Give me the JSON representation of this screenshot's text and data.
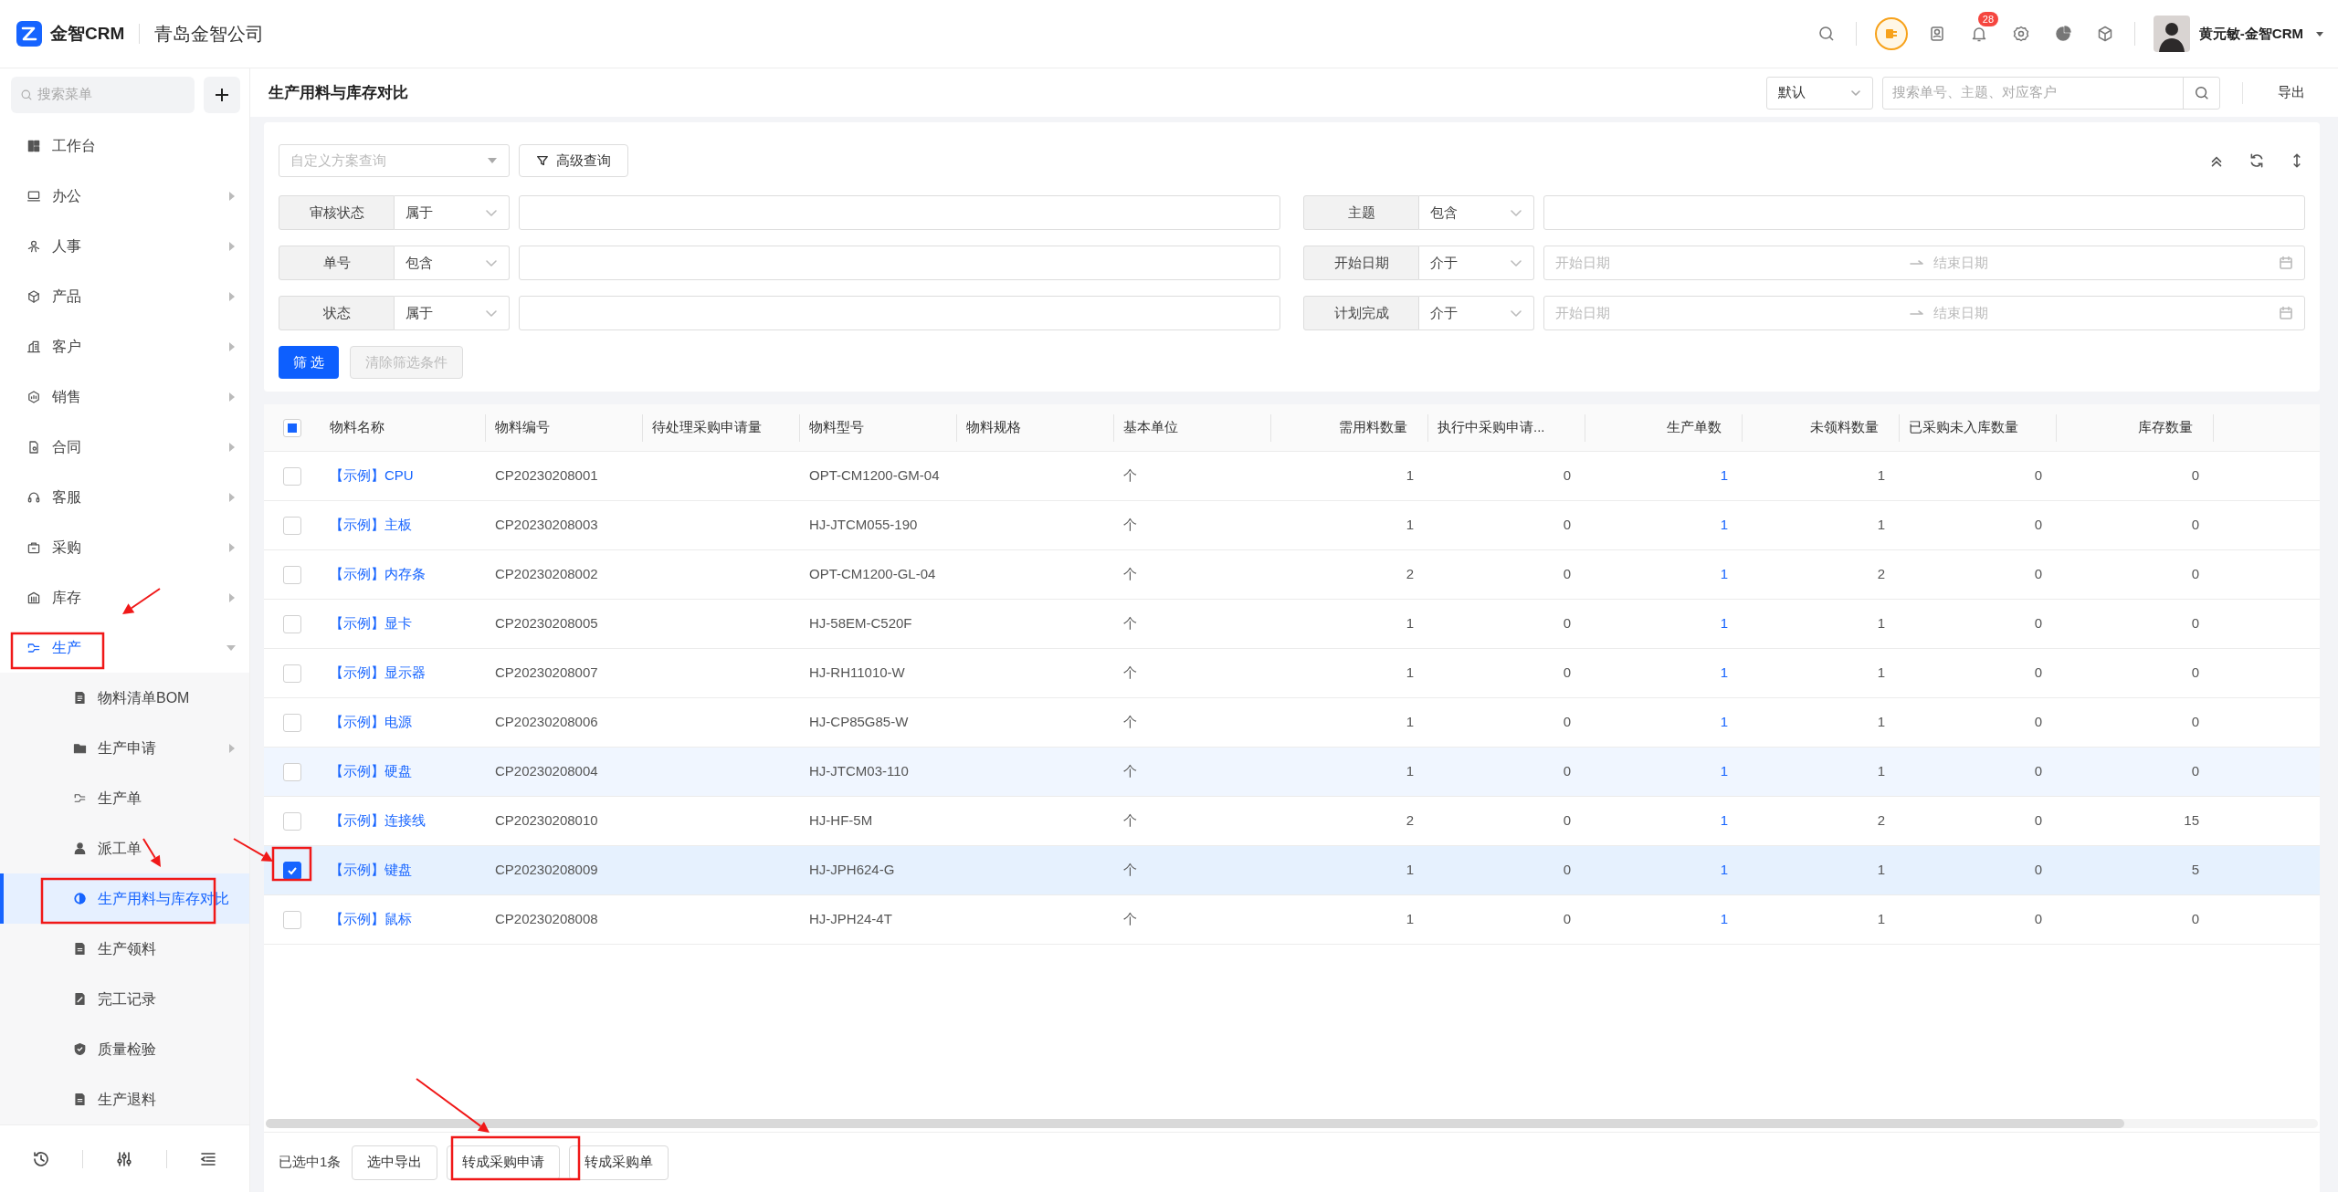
{
  "header": {
    "logo_text": "金智CRM",
    "company": "青岛金智公司",
    "notification_count": "28",
    "user_name": "黄元敏-金智CRM"
  },
  "sidebar": {
    "search_placeholder": "搜索菜单",
    "items": [
      {
        "label": "工作台",
        "selected": false
      },
      {
        "label": "办公",
        "selected": false,
        "expanded": false
      },
      {
        "label": "人事",
        "selected": false,
        "expanded": false
      },
      {
        "label": "产品",
        "selected": false,
        "expanded": false
      },
      {
        "label": "客户",
        "selected": false,
        "expanded": false
      },
      {
        "label": "销售",
        "selected": false,
        "expanded": false
      },
      {
        "label": "合同",
        "selected": false,
        "expanded": false
      },
      {
        "label": "客服",
        "selected": false,
        "expanded": false
      },
      {
        "label": "采购",
        "selected": false,
        "expanded": false
      },
      {
        "label": "库存",
        "selected": false,
        "expanded": false
      },
      {
        "label": "生产",
        "selected": false,
        "expanded": true,
        "children": [
          {
            "label": "物料清单BOM",
            "selected": false
          },
          {
            "label": "生产申请",
            "selected": false,
            "expanded": false
          },
          {
            "label": "生产单",
            "selected": false
          },
          {
            "label": "派工单",
            "selected": false
          },
          {
            "label": "生产用料与库存对比",
            "selected": true
          },
          {
            "label": "生产领料",
            "selected": false
          },
          {
            "label": "完工记录",
            "selected": false
          },
          {
            "label": "质量检验",
            "selected": false
          },
          {
            "label": "生产退料",
            "selected": false
          }
        ]
      }
    ]
  },
  "page": {
    "title": "生产用料与库存对比",
    "view_select": "默认",
    "search_placeholder": "搜索单号、主题、对应客户",
    "export": "导出"
  },
  "filter": {
    "scheme_placeholder": "自定义方案查询",
    "advanced_button": "高级查询",
    "fields": [
      {
        "label": "审核状态",
        "operator": "属于",
        "kind": "text"
      },
      {
        "label": "主题",
        "operator": "包含",
        "kind": "text"
      },
      {
        "label": "单号",
        "operator": "包含",
        "kind": "text"
      },
      {
        "label": "开始日期",
        "operator": "介于",
        "kind": "date_range",
        "start_placeholder": "开始日期",
        "end_placeholder": "结束日期"
      },
      {
        "label": "状态",
        "operator": "属于",
        "kind": "text"
      },
      {
        "label": "计划完成",
        "operator": "介于",
        "kind": "date_range",
        "start_placeholder": "开始日期",
        "end_placeholder": "结束日期"
      }
    ],
    "apply_button": "筛 选",
    "clear_button": {
      "label": "清除筛选条件",
      "disabled": true
    }
  },
  "table": {
    "select_all": {
      "partial": true
    },
    "columns": [
      "物料名称",
      "物料编号",
      "待处理采购申请量",
      "物料型号",
      "物料规格",
      "基本单位",
      "需用料数量",
      "执行中采购申请...",
      "生产单数",
      "未领料数量",
      "已采购未入库数量",
      "库存数量"
    ],
    "rows": [
      {
        "name": "【示例】CPU",
        "code": "CP20230208001",
        "model": "OPT-CM1200-GM-04",
        "unit": "个",
        "required": "1",
        "in_progress": "0",
        "orders": "1",
        "unissued": "1",
        "purchased": "0",
        "stock": "0",
        "selected": false,
        "hovered": false
      },
      {
        "name": "【示例】主板",
        "code": "CP20230208003",
        "model": "HJ-JTCM055-190",
        "unit": "个",
        "required": "1",
        "in_progress": "0",
        "orders": "1",
        "unissued": "1",
        "purchased": "0",
        "stock": "0",
        "selected": false,
        "hovered": false
      },
      {
        "name": "【示例】内存条",
        "code": "CP20230208002",
        "model": "OPT-CM1200-GL-04",
        "unit": "个",
        "required": "2",
        "in_progress": "0",
        "orders": "1",
        "unissued": "2",
        "purchased": "0",
        "stock": "0",
        "selected": false,
        "hovered": false
      },
      {
        "name": "【示例】显卡",
        "code": "CP20230208005",
        "model": "HJ-58EM-C520F",
        "unit": "个",
        "required": "1",
        "in_progress": "0",
        "orders": "1",
        "unissued": "1",
        "purchased": "0",
        "stock": "0",
        "selected": false,
        "hovered": false
      },
      {
        "name": "【示例】显示器",
        "code": "CP20230208007",
        "model": "HJ-RH11010-W",
        "unit": "个",
        "required": "1",
        "in_progress": "0",
        "orders": "1",
        "unissued": "1",
        "purchased": "0",
        "stock": "0",
        "selected": false,
        "hovered": false
      },
      {
        "name": "【示例】电源",
        "code": "CP20230208006",
        "model": "HJ-CP85G85-W",
        "unit": "个",
        "required": "1",
        "in_progress": "0",
        "orders": "1",
        "unissued": "1",
        "purchased": "0",
        "stock": "0",
        "selected": false,
        "hovered": false
      },
      {
        "name": "【示例】硬盘",
        "code": "CP20230208004",
        "model": "HJ-JTCM03-110",
        "unit": "个",
        "required": "1",
        "in_progress": "0",
        "orders": "1",
        "unissued": "1",
        "purchased": "0",
        "stock": "0",
        "selected": false,
        "hovered": true
      },
      {
        "name": "【示例】连接线",
        "code": "CP20230208010",
        "model": "HJ-HF-5M",
        "unit": "个",
        "required": "2",
        "in_progress": "0",
        "orders": "1",
        "unissued": "2",
        "purchased": "0",
        "stock": "15",
        "selected": false,
        "hovered": false
      },
      {
        "name": "【示例】键盘",
        "code": "CP20230208009",
        "model": "HJ-JPH624-G",
        "unit": "个",
        "required": "1",
        "in_progress": "0",
        "orders": "1",
        "unissued": "1",
        "purchased": "0",
        "stock": "5",
        "selected": true,
        "hovered": false
      },
      {
        "name": "【示例】鼠标",
        "code": "CP20230208008",
        "model": "HJ-JPH24-4T",
        "unit": "个",
        "required": "1",
        "in_progress": "0",
        "orders": "1",
        "unissued": "1",
        "purchased": "0",
        "stock": "0",
        "selected": false,
        "hovered": false
      }
    ]
  },
  "footer": {
    "selected_count": "已选中1条",
    "buttons": [
      "选中导出",
      "转成采购申请",
      "转成采购单"
    ]
  }
}
